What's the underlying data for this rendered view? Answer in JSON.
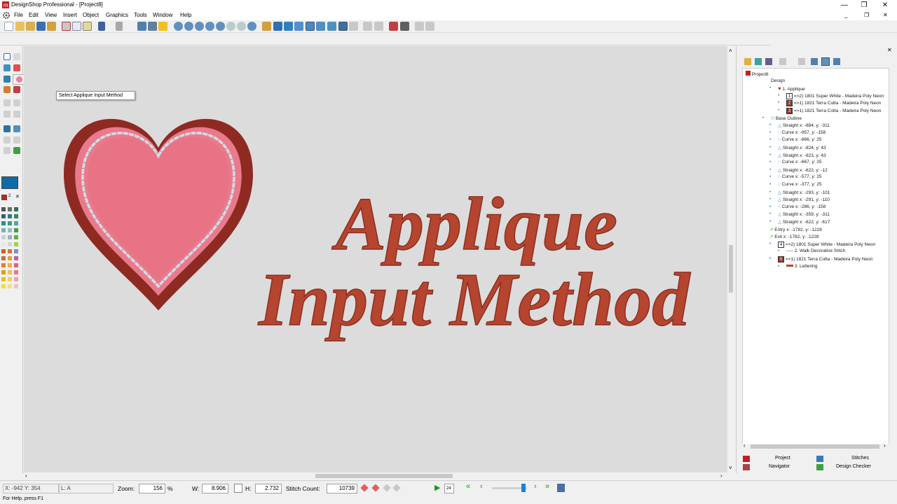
{
  "window": {
    "title": "DesignShop Professional - [Project8]",
    "controls": {
      "minimize": "—",
      "restore": "❐",
      "close": "✕"
    }
  },
  "menu": [
    "File",
    "Edit",
    "View",
    "Insert",
    "Object",
    "Graphics",
    "Tools",
    "Window",
    "Help"
  ],
  "tooltip": "Select Applique Input Method",
  "design": {
    "text_line1": "Applique",
    "text_line2": "Input Method",
    "colors": {
      "thread_terracotta": "#b5452f",
      "heart_fill": "#e97a8c",
      "heart_outline": "#8e2a22",
      "walk_stitch": "#d0dde5",
      "canvas": "#dcdcdc"
    }
  },
  "tree": {
    "root": "Project8",
    "items": [
      "Design",
      "1. Applique",
      "=>2) 1801 Super White - Madeira Poly Neon",
      "=>1) 1821 Terra Cotta - Madeira Poly Neon",
      "=>1) 1821 Terra Cotta - Madeira Poly Neon",
      "Base Outline",
      "Straight  x: -884, y: -311",
      "Curve  x: -957, y: -158",
      "Curve  x: -866, y: 25",
      "Straight  x: -824, y: 43",
      "Straight  x: -823, y: 43",
      "Curve  x: -667, y: 25",
      "Straight  x: -622, y: -12",
      "Curve  x: -577, y: 25",
      "Curve  x: -377, y: 25",
      "Straight  x: -293, y: -101",
      "Straight  x: -291, y: -110",
      "Curve  x: -286, y: -158",
      "Straight  x: -359, y: -311",
      "Straight  x: -622, y: -617",
      "Entry  x: -1782, y: -1228",
      "Exit  x: -1782, y: -1228",
      "=>2) 1801 Super White - Madeira Poly Neon",
      "2. Walk Decorative Stitch",
      "=>1) 1821 Terra Cotta - Madeira Poly Neon",
      "3. Lettering"
    ],
    "badges": [
      "1",
      "2",
      "3",
      "4",
      "5"
    ]
  },
  "panel_tabs": {
    "project": "Project",
    "stitches": "Stitches",
    "navigator": "Navigator",
    "design_checker": "Design Checker"
  },
  "status": {
    "coords": "X: -942  Y: 354",
    "layer": "L: A",
    "zoom_label": "Zoom:",
    "zoom_value": "156",
    "zoom_unit": "%",
    "w_label": "W:",
    "w_value": "8.906",
    "h_label": "H:",
    "h_value": "2.732",
    "stitch_label": "Stitch Count:",
    "stitch_value": "10739",
    "speed_value": "24",
    "help": "For Help, press F1"
  }
}
